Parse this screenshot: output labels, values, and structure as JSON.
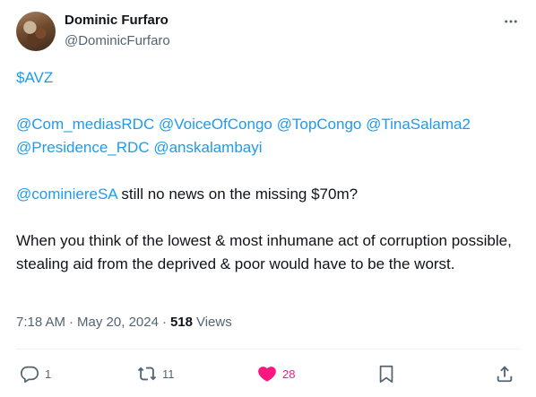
{
  "author": {
    "name": "Dominic Furfaro",
    "handle": "@DominicFurfaro"
  },
  "tweet": {
    "cashtag": "$AVZ",
    "mentions_line1": [
      "@Com_mediasRDC",
      "@VoiceOfCongo",
      "@TopCongo",
      "@TinaSalama2"
    ],
    "mentions_line2": [
      "@Presidence_RDC",
      "@anskalambayi"
    ],
    "mention_cominiere": "@cominiereSA",
    "line3_text": " still no news on the missing $70m?",
    "paragraph": "When you think of the lowest & most inhumane act of corruption possible, stealing aid from the deprived & poor would have to be the worst."
  },
  "meta": {
    "time": "7:18 AM",
    "date": "May 20, 2024",
    "views_count": "518",
    "views_label": "Views",
    "sep1": "·",
    "sep2": "·"
  },
  "actions": {
    "reply_count": "1",
    "retweet_count": "11",
    "like_count": "28"
  },
  "colors": {
    "link": "#1d9bf0",
    "like": "#f91880",
    "muted": "#536471",
    "text": "#0f1419"
  }
}
